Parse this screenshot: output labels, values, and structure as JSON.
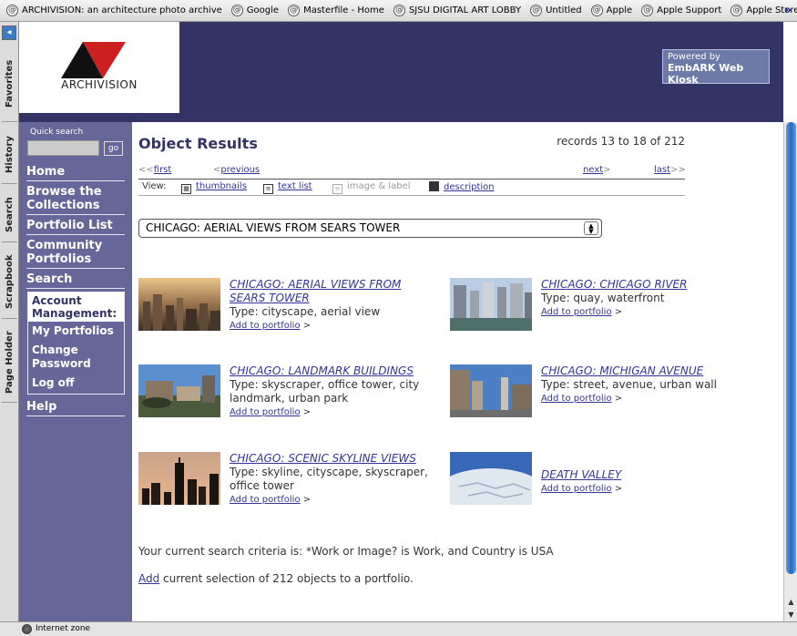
{
  "favorites": [
    "ARCHIVISION: an architecture photo archive",
    "Google",
    "Masterfile - Home",
    "SJSU DIGITAL ART LOBBY",
    "Untitled",
    "Apple",
    "Apple Support",
    "Apple Store"
  ],
  "side_tabs": [
    "Favorites",
    "History",
    "Search",
    "Scrapbook",
    "Page Holder"
  ],
  "header": {
    "logo_text": "ARCHIVISION",
    "powered_line1": "Powered by",
    "powered_line2": "EmbARK Web Kiosk"
  },
  "nav": {
    "quick_search_label": "Quick search",
    "go_label": "go",
    "home": "Home",
    "browse": "Browse the Collections",
    "portfolio_list": "Portfolio List",
    "community": "Community Portfolios",
    "search": "Search",
    "account_management": "Account Management:",
    "my_portfolios": "My Portfolios",
    "change_password": "Change Password",
    "log_off": "Log off",
    "help": "Help"
  },
  "main": {
    "title": "Object Results",
    "records": "records 13 to 18 of 212",
    "pager": {
      "first_prefix": "<<",
      "first": "first",
      "previous_prefix": "<",
      "previous": "previous",
      "next": "next",
      "next_suffix": ">",
      "last": "last",
      "last_suffix": ">>"
    },
    "view_label": "View:",
    "views": {
      "thumbnails": "thumbnails",
      "text_list": "text list",
      "image_label": "image & label",
      "description": "description"
    },
    "selected_set": "CHICAGO: AERIAL VIEWS FROM SEARS TOWER",
    "add_to_portfolio": "Add to portfolio",
    "results": [
      {
        "title": "CHICAGO: AERIAL VIEWS FROM SEARS TOWER",
        "type": "Type: cityscape, aerial view"
      },
      {
        "title": "CHICAGO: CHICAGO RIVER",
        "type": "Type: quay, waterfront"
      },
      {
        "title": "CHICAGO: LANDMARK BUILDINGS",
        "type": "Type: skyscraper, office tower, city landmark, urban park"
      },
      {
        "title": "CHICAGO: MICHIGAN AVENUE",
        "type": "Type: street, avenue, urban wall"
      },
      {
        "title": "CHICAGO: SCENIC SKYLINE VIEWS",
        "type": "Type: skyline, cityscape, skyscraper, office tower"
      },
      {
        "title": "DEATH VALLEY",
        "type": ""
      }
    ],
    "criteria": "Your current search criteria is: *Work or Image? is Work, and Country is USA",
    "add_link": "Add",
    "add_rest": " current selection of 212 objects to a portfolio."
  },
  "status": {
    "zone": "Internet zone"
  },
  "colors": {
    "header": "#333366",
    "nav": "#666699",
    "link": "#333399"
  }
}
